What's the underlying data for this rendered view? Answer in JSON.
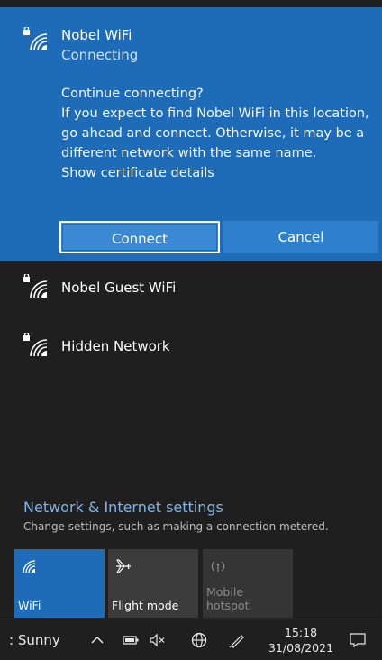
{
  "selected_network": {
    "name": "Nobel WiFi",
    "status": "Connecting",
    "prompt_lines": [
      "Continue connecting?",
      "If you expect to find Nobel WiFi in this location,",
      "go ahead and connect. Otherwise, it may be a",
      "different network with the same name.",
      "Show certificate details"
    ],
    "connect_label": "Connect",
    "cancel_label": "Cancel",
    "icon": "wifi-secured-icon"
  },
  "networks": [
    {
      "name": "Nobel Guest WiFi",
      "icon": "wifi-secured-icon"
    },
    {
      "name": "Hidden Network",
      "icon": "wifi-secured-icon"
    }
  ],
  "settings": {
    "title": "Network & Internet settings",
    "subtitle": "Change settings, such as making a connection metered."
  },
  "quick_actions": [
    {
      "label": "WiFi",
      "icon": "wifi-icon",
      "state": "on"
    },
    {
      "label": "Flight mode",
      "icon": "airplane-icon",
      "state": "off"
    },
    {
      "label_line1": "Mobile",
      "label_line2": "hotspot",
      "icon": "hotspot-icon",
      "state": "disabled"
    }
  ],
  "taskbar": {
    "weather": "Sunny",
    "time": "15:18",
    "date": "31/08/2021"
  },
  "colors": {
    "accent": "#1e6bb8",
    "background": "#1f1f1f",
    "link": "#7fb5ea"
  }
}
